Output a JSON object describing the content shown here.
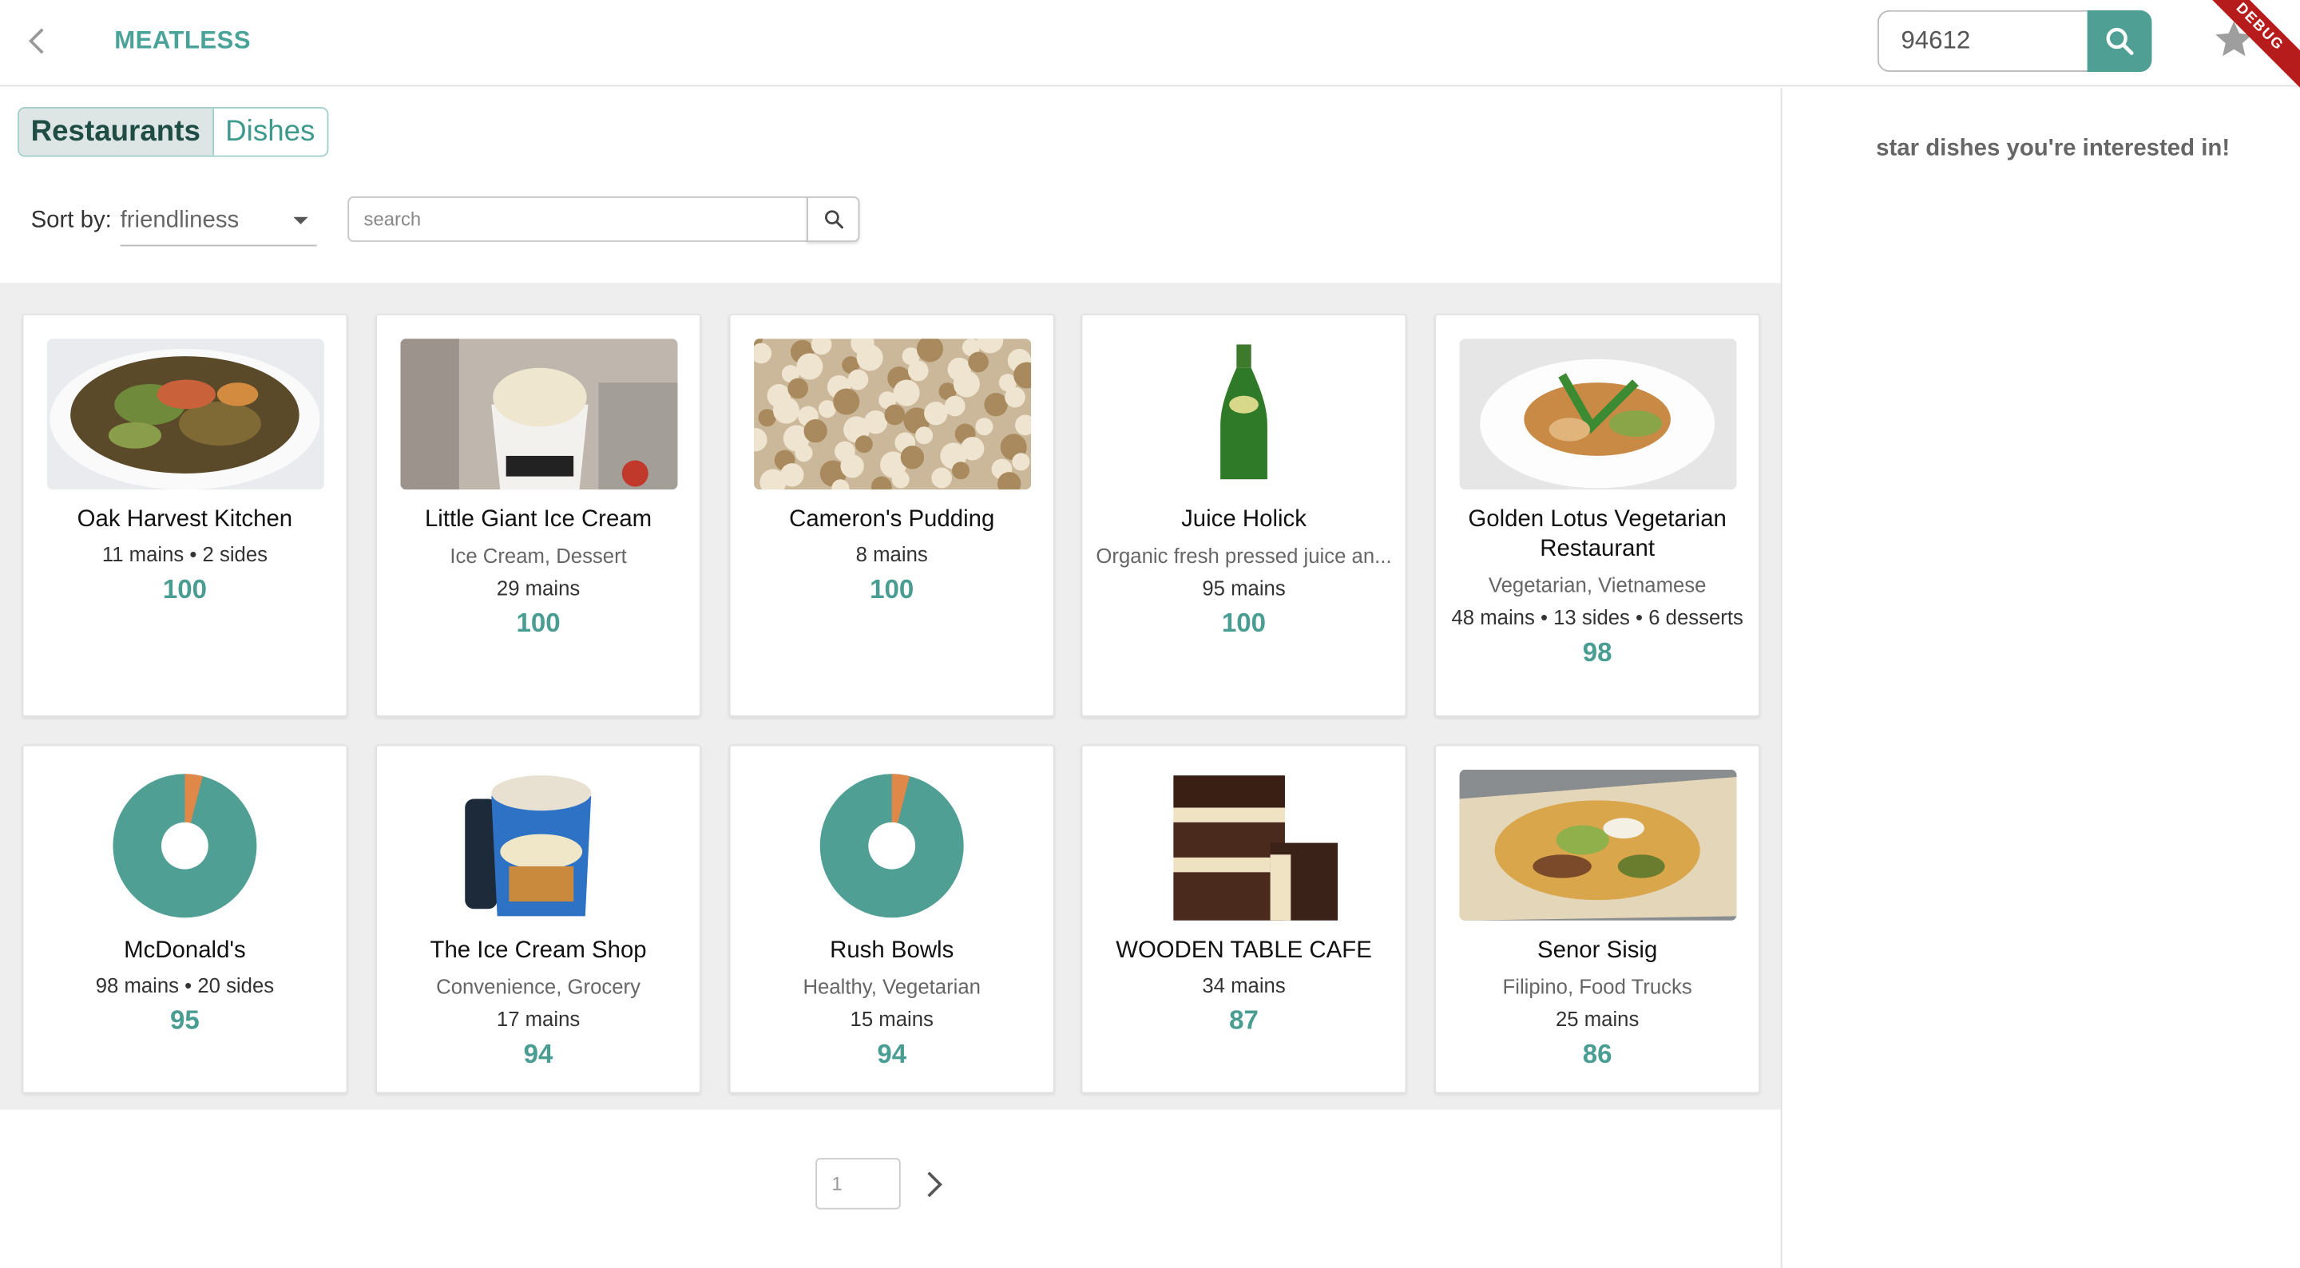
{
  "app": {
    "title": "MEATLESS"
  },
  "header": {
    "zip_value": "94612",
    "debug_label": "DEBUG"
  },
  "side": {
    "hint": "star dishes you're interested in!"
  },
  "tabs": [
    {
      "label": "Restaurants",
      "active": true
    },
    {
      "label": "Dishes",
      "active": false
    }
  ],
  "sort": {
    "label": "Sort by:",
    "value": "friendliness"
  },
  "search": {
    "placeholder": "search"
  },
  "restaurants": [
    {
      "name": "Oak Harvest Kitchen",
      "categories": "",
      "counts": "11 mains • 2 sides",
      "score": "100",
      "image": "salad"
    },
    {
      "name": "Little Giant Ice Cream",
      "categories": "Ice Cream, Dessert",
      "counts": "29 mains",
      "score": "100",
      "image": "ice-cream-cup"
    },
    {
      "name": "Cameron's Pudding",
      "categories": "",
      "counts": "8 mains",
      "score": "100",
      "image": "popcorn"
    },
    {
      "name": "Juice Holick",
      "categories": "Organic fresh pressed juice an...",
      "counts": "95 mains",
      "score": "100",
      "image": "green-bottle"
    },
    {
      "name": "Golden Lotus Vegetarian Restaurant",
      "categories": "Vegetarian, Vietnamese",
      "counts": "48 mains • 13 sides • 6 desserts",
      "score": "98",
      "image": "plate"
    },
    {
      "name": "McDonald's",
      "categories": "",
      "counts": "98 mains • 20 sides",
      "score": "95",
      "image": "donut-chart"
    },
    {
      "name": "The Ice Cream Shop",
      "categories": "Convenience, Grocery",
      "counts": "17 mains",
      "score": "94",
      "image": "pint"
    },
    {
      "name": "Rush Bowls",
      "categories": "Healthy, Vegetarian",
      "counts": "15 mains",
      "score": "94",
      "image": "donut-chart"
    },
    {
      "name": "WOODEN TABLE CAFE",
      "categories": "",
      "counts": "34 mains",
      "score": "87",
      "image": "brownies"
    },
    {
      "name": "Senor Sisig",
      "categories": "Filipino, Food Trucks",
      "counts": "25 mains",
      "score": "86",
      "image": "nachos"
    }
  ],
  "pager": {
    "page": "1"
  },
  "colors": {
    "accent": "#4f9f94",
    "donut_main": "#4f9f94",
    "donut_slice": "#e0884a"
  }
}
